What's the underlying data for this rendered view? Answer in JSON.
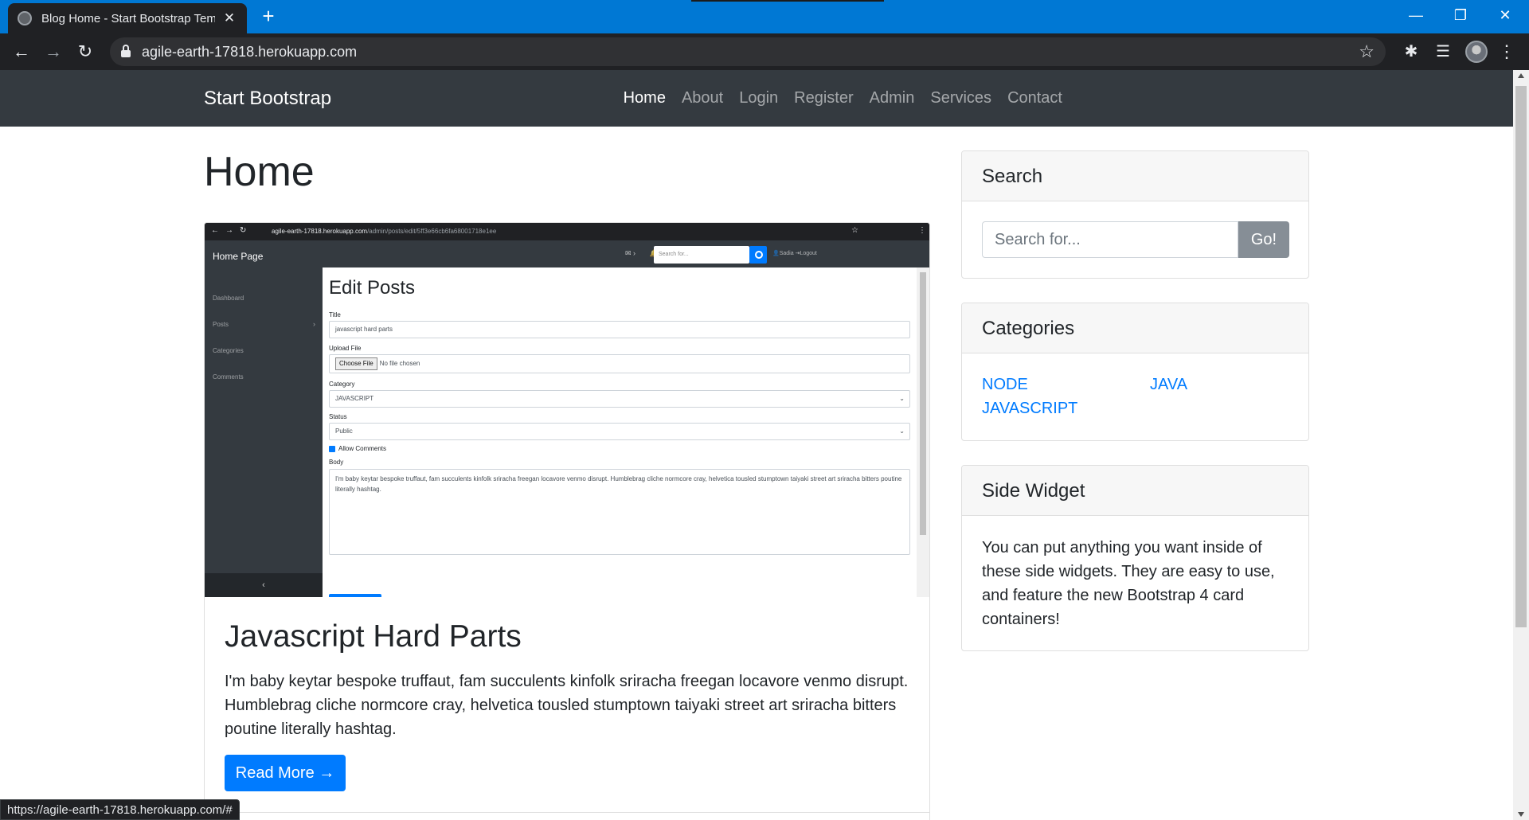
{
  "browser": {
    "tab_title": "Blog Home - Start Bootstrap Tem",
    "url": "agile-earth-17818.herokuapp.com",
    "status_url": "https://agile-earth-17818.herokuapp.com/#"
  },
  "navbar": {
    "brand": "Start Bootstrap",
    "links": [
      "Home",
      "About",
      "Login",
      "Register",
      "Admin",
      "Services",
      "Contact"
    ]
  },
  "main": {
    "heading": "Home",
    "post": {
      "title": "Javascript Hard Parts",
      "excerpt": "I'm baby keytar bespoke truffaut, fam succulents kinfolk sriracha freegan locavore venmo disrupt. Humblebrag cliche normcore cray, helvetica tousled stumptown taiyaki street art sriracha bitters poutine literally hashtag.",
      "read_more": "Read More →",
      "image": {
        "url_host": "agile-earth-17818.herokuapp.com",
        "url_path": "/admin/posts/edit/5ff3e66cb6fa68001718e1ee",
        "brand": "Home Page",
        "sidebar": [
          "Dashboard",
          "Posts",
          "Categories",
          "Comments"
        ],
        "search_placeholder": "Search for...",
        "user": "Sadia",
        "logout": "Logout",
        "heading": "Edit Posts",
        "title_label": "Title",
        "title_value": "javascript hard parts",
        "upload_label": "Upload File",
        "choose_file": "Choose File",
        "no_file": "No file chosen",
        "category_label": "Category",
        "category_value": "JAVASCRIPT",
        "status_label": "Status",
        "status_value": "Public",
        "allow_comments": "Allow Comments",
        "body_label": "Body",
        "body_value": "I'm baby keytar bespoke truffaut, fam succulents kinfolk sriracha freegan locavore venmo disrupt. Humblebrag cliche normcore cray, helvetica tousled stumptown taiyaki street art sriracha bitters poutine literally hashtag."
      }
    }
  },
  "sidebar": {
    "search": {
      "title": "Search",
      "placeholder": "Search for...",
      "button": "Go!"
    },
    "categories": {
      "title": "Categories",
      "items": [
        "NODE",
        "JAVA",
        "JAVASCRIPT"
      ]
    },
    "side_widget": {
      "title": "Side Widget",
      "text": "You can put anything you want inside of these side widgets. They are easy to use, and feature the new Bootstrap 4 card containers!"
    }
  },
  "colors": {
    "browser_accent": "#0078d4",
    "navbar_bg": "#343a40",
    "primary": "#007bff",
    "secondary_button": "#868e96"
  }
}
